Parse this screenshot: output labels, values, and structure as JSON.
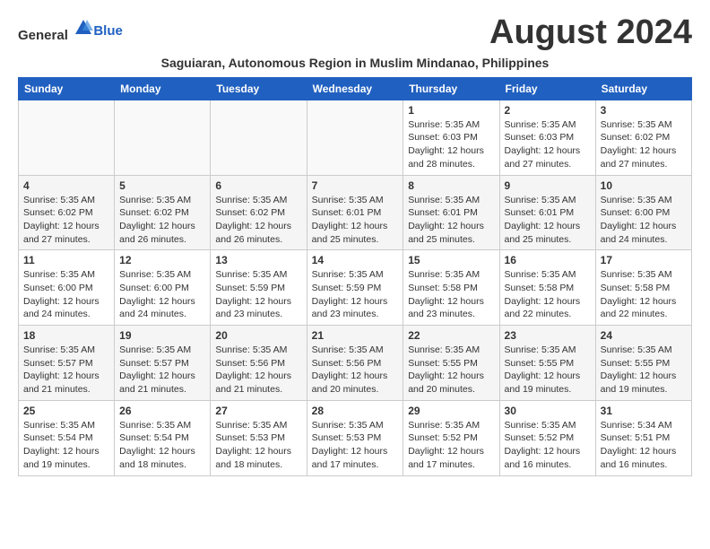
{
  "header": {
    "logo_general": "General",
    "logo_blue": "Blue",
    "month_year": "August 2024",
    "location": "Saguiaran, Autonomous Region in Muslim Mindanao, Philippines"
  },
  "days_of_week": [
    "Sunday",
    "Monday",
    "Tuesday",
    "Wednesday",
    "Thursday",
    "Friday",
    "Saturday"
  ],
  "weeks": [
    {
      "days": [
        {
          "number": "",
          "sunrise": "",
          "sunset": "",
          "daylight": ""
        },
        {
          "number": "",
          "sunrise": "",
          "sunset": "",
          "daylight": ""
        },
        {
          "number": "",
          "sunrise": "",
          "sunset": "",
          "daylight": ""
        },
        {
          "number": "",
          "sunrise": "",
          "sunset": "",
          "daylight": ""
        },
        {
          "number": "1",
          "sunrise": "5:35 AM",
          "sunset": "6:03 PM",
          "daylight": "12 hours and 28 minutes."
        },
        {
          "number": "2",
          "sunrise": "5:35 AM",
          "sunset": "6:03 PM",
          "daylight": "12 hours and 27 minutes."
        },
        {
          "number": "3",
          "sunrise": "5:35 AM",
          "sunset": "6:02 PM",
          "daylight": "12 hours and 27 minutes."
        }
      ]
    },
    {
      "days": [
        {
          "number": "4",
          "sunrise": "5:35 AM",
          "sunset": "6:02 PM",
          "daylight": "12 hours and 27 minutes."
        },
        {
          "number": "5",
          "sunrise": "5:35 AM",
          "sunset": "6:02 PM",
          "daylight": "12 hours and 26 minutes."
        },
        {
          "number": "6",
          "sunrise": "5:35 AM",
          "sunset": "6:02 PM",
          "daylight": "12 hours and 26 minutes."
        },
        {
          "number": "7",
          "sunrise": "5:35 AM",
          "sunset": "6:01 PM",
          "daylight": "12 hours and 25 minutes."
        },
        {
          "number": "8",
          "sunrise": "5:35 AM",
          "sunset": "6:01 PM",
          "daylight": "12 hours and 25 minutes."
        },
        {
          "number": "9",
          "sunrise": "5:35 AM",
          "sunset": "6:01 PM",
          "daylight": "12 hours and 25 minutes."
        },
        {
          "number": "10",
          "sunrise": "5:35 AM",
          "sunset": "6:00 PM",
          "daylight": "12 hours and 24 minutes."
        }
      ]
    },
    {
      "days": [
        {
          "number": "11",
          "sunrise": "5:35 AM",
          "sunset": "6:00 PM",
          "daylight": "12 hours and 24 minutes."
        },
        {
          "number": "12",
          "sunrise": "5:35 AM",
          "sunset": "6:00 PM",
          "daylight": "12 hours and 24 minutes."
        },
        {
          "number": "13",
          "sunrise": "5:35 AM",
          "sunset": "5:59 PM",
          "daylight": "12 hours and 23 minutes."
        },
        {
          "number": "14",
          "sunrise": "5:35 AM",
          "sunset": "5:59 PM",
          "daylight": "12 hours and 23 minutes."
        },
        {
          "number": "15",
          "sunrise": "5:35 AM",
          "sunset": "5:58 PM",
          "daylight": "12 hours and 23 minutes."
        },
        {
          "number": "16",
          "sunrise": "5:35 AM",
          "sunset": "5:58 PM",
          "daylight": "12 hours and 22 minutes."
        },
        {
          "number": "17",
          "sunrise": "5:35 AM",
          "sunset": "5:58 PM",
          "daylight": "12 hours and 22 minutes."
        }
      ]
    },
    {
      "days": [
        {
          "number": "18",
          "sunrise": "5:35 AM",
          "sunset": "5:57 PM",
          "daylight": "12 hours and 21 minutes."
        },
        {
          "number": "19",
          "sunrise": "5:35 AM",
          "sunset": "5:57 PM",
          "daylight": "12 hours and 21 minutes."
        },
        {
          "number": "20",
          "sunrise": "5:35 AM",
          "sunset": "5:56 PM",
          "daylight": "12 hours and 21 minutes."
        },
        {
          "number": "21",
          "sunrise": "5:35 AM",
          "sunset": "5:56 PM",
          "daylight": "12 hours and 20 minutes."
        },
        {
          "number": "22",
          "sunrise": "5:35 AM",
          "sunset": "5:55 PM",
          "daylight": "12 hours and 20 minutes."
        },
        {
          "number": "23",
          "sunrise": "5:35 AM",
          "sunset": "5:55 PM",
          "daylight": "12 hours and 19 minutes."
        },
        {
          "number": "24",
          "sunrise": "5:35 AM",
          "sunset": "5:55 PM",
          "daylight": "12 hours and 19 minutes."
        }
      ]
    },
    {
      "days": [
        {
          "number": "25",
          "sunrise": "5:35 AM",
          "sunset": "5:54 PM",
          "daylight": "12 hours and 19 minutes."
        },
        {
          "number": "26",
          "sunrise": "5:35 AM",
          "sunset": "5:54 PM",
          "daylight": "12 hours and 18 minutes."
        },
        {
          "number": "27",
          "sunrise": "5:35 AM",
          "sunset": "5:53 PM",
          "daylight": "12 hours and 18 minutes."
        },
        {
          "number": "28",
          "sunrise": "5:35 AM",
          "sunset": "5:53 PM",
          "daylight": "12 hours and 17 minutes."
        },
        {
          "number": "29",
          "sunrise": "5:35 AM",
          "sunset": "5:52 PM",
          "daylight": "12 hours and 17 minutes."
        },
        {
          "number": "30",
          "sunrise": "5:35 AM",
          "sunset": "5:52 PM",
          "daylight": "12 hours and 16 minutes."
        },
        {
          "number": "31",
          "sunrise": "5:34 AM",
          "sunset": "5:51 PM",
          "daylight": "12 hours and 16 minutes."
        }
      ]
    }
  ]
}
